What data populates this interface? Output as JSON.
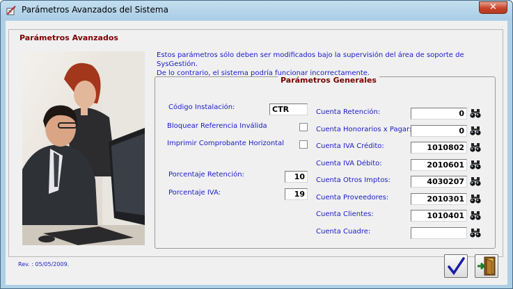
{
  "window": {
    "title": "Parámetros Avanzados del Sistema",
    "close_label": "✕"
  },
  "group": {
    "title": "Parámetros Avanzados",
    "info_line1": "Estos parámetros sólo deben ser modificados bajo la supervisión del área de soporte de SysGestión.",
    "info_line2": "De lo contrario, el sistema podría funcionar incorrectamente."
  },
  "general": {
    "title": "Parámetros Generales",
    "codigo_instalacion": {
      "label": "Código Instalación:",
      "value": "CTR"
    },
    "bloquear_referencia": {
      "label": "Bloquear Referencia Inválida",
      "checked": false
    },
    "imprimir_comprobante": {
      "label": "Imprimir Comprobante Horizontal",
      "checked": false
    },
    "porcentaje_retencion": {
      "label": "Porcentaje Retención:",
      "value": "10"
    },
    "porcentaje_iva": {
      "label": "Porcentaje IVA:",
      "value": "19"
    },
    "cuentas": [
      {
        "label": "Cuenta Retención:",
        "value": "0"
      },
      {
        "label": "Cuenta Honorarios x Pagar:",
        "value": "0"
      },
      {
        "label": "Cuenta IVA Crédito:",
        "value": "1010802"
      },
      {
        "label": "Cuenta IVA Débito:",
        "value": "2010601"
      },
      {
        "label": "Cuenta Otros Imptos:",
        "value": "4030207"
      },
      {
        "label": "Cuenta Proveedores:",
        "value": "2010301"
      },
      {
        "label": "Cuenta Clientes:",
        "value": "1010401"
      },
      {
        "label": "Cuenta Cuadre:",
        "value": ""
      }
    ],
    "search_icon": "binoculars-icon"
  },
  "footer": {
    "revision": "Rev. : 05/05/2009.",
    "accept_icon": "checkmark-icon",
    "exit_icon": "exit-door-icon"
  }
}
